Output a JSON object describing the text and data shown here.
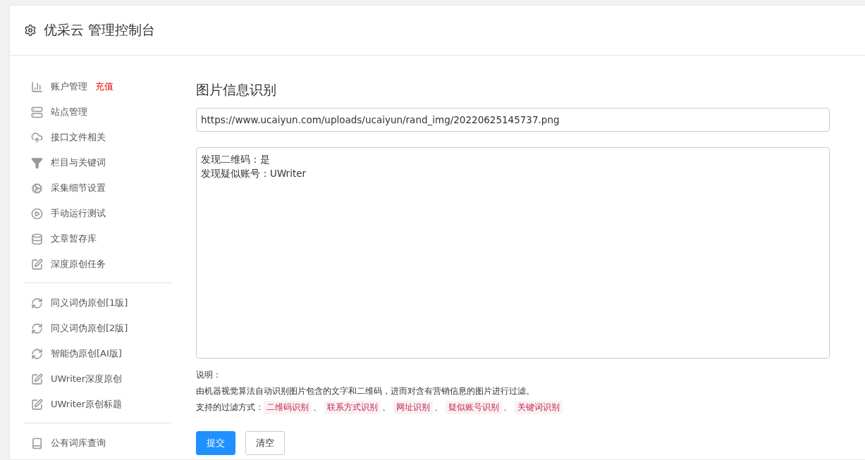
{
  "header": {
    "title": "优采云 管理控制台"
  },
  "sidebar": {
    "groups": [
      {
        "items": [
          {
            "kind": "chart",
            "label": "账户管理",
            "badge": "充值"
          },
          {
            "kind": "server",
            "label": "站点管理"
          },
          {
            "kind": "cloud",
            "label": "接口文件相关"
          },
          {
            "kind": "filter",
            "label": "栏目与关键词"
          },
          {
            "kind": "gears",
            "label": "采集细节设置"
          },
          {
            "kind": "play",
            "label": "手动运行测试"
          },
          {
            "kind": "database",
            "label": "文章暂存库"
          },
          {
            "kind": "edit",
            "label": "深度原创任务"
          }
        ]
      },
      {
        "items": [
          {
            "kind": "refresh",
            "label": "同义词伪原创[1版]"
          },
          {
            "kind": "refresh",
            "label": "同义词伪原创[2版]"
          },
          {
            "kind": "refresh",
            "label": "智能伪原创[AI版]"
          },
          {
            "kind": "edit",
            "label": "UWriter深度原创"
          },
          {
            "kind": "edit",
            "label": "UWriter原创标题"
          }
        ]
      },
      {
        "items": [
          {
            "kind": "book",
            "label": "公有词库查询"
          }
        ]
      }
    ]
  },
  "main": {
    "title": "图片信息识别",
    "url_field": {
      "value": "https://www.ucaiyun.com/uploads/ucaiyun/rand_img/20220625145737.png"
    },
    "result_box": {
      "lines": [
        "发现二维码：是",
        "发现疑似账号：UWriter"
      ]
    },
    "notes": {
      "heading": "说明：",
      "description": "由机器视觉算法自动识别图片包含的文字和二维码，进而对含有营销信息的图片进行过滤。",
      "methods_label": "支持的过滤方式：",
      "methods": [
        {
          "label": "二维码识别",
          "separator": "、"
        },
        {
          "label": "联系方式识别",
          "separator": "、"
        },
        {
          "label": "网址识别",
          "separator": "、"
        },
        {
          "label": "疑似账号识别",
          "separator": "、"
        },
        {
          "label": "关键词识别"
        }
      ]
    },
    "buttons": [
      {
        "label": "提交",
        "kind": "primary"
      },
      {
        "label": "清空",
        "kind": "default"
      }
    ]
  }
}
